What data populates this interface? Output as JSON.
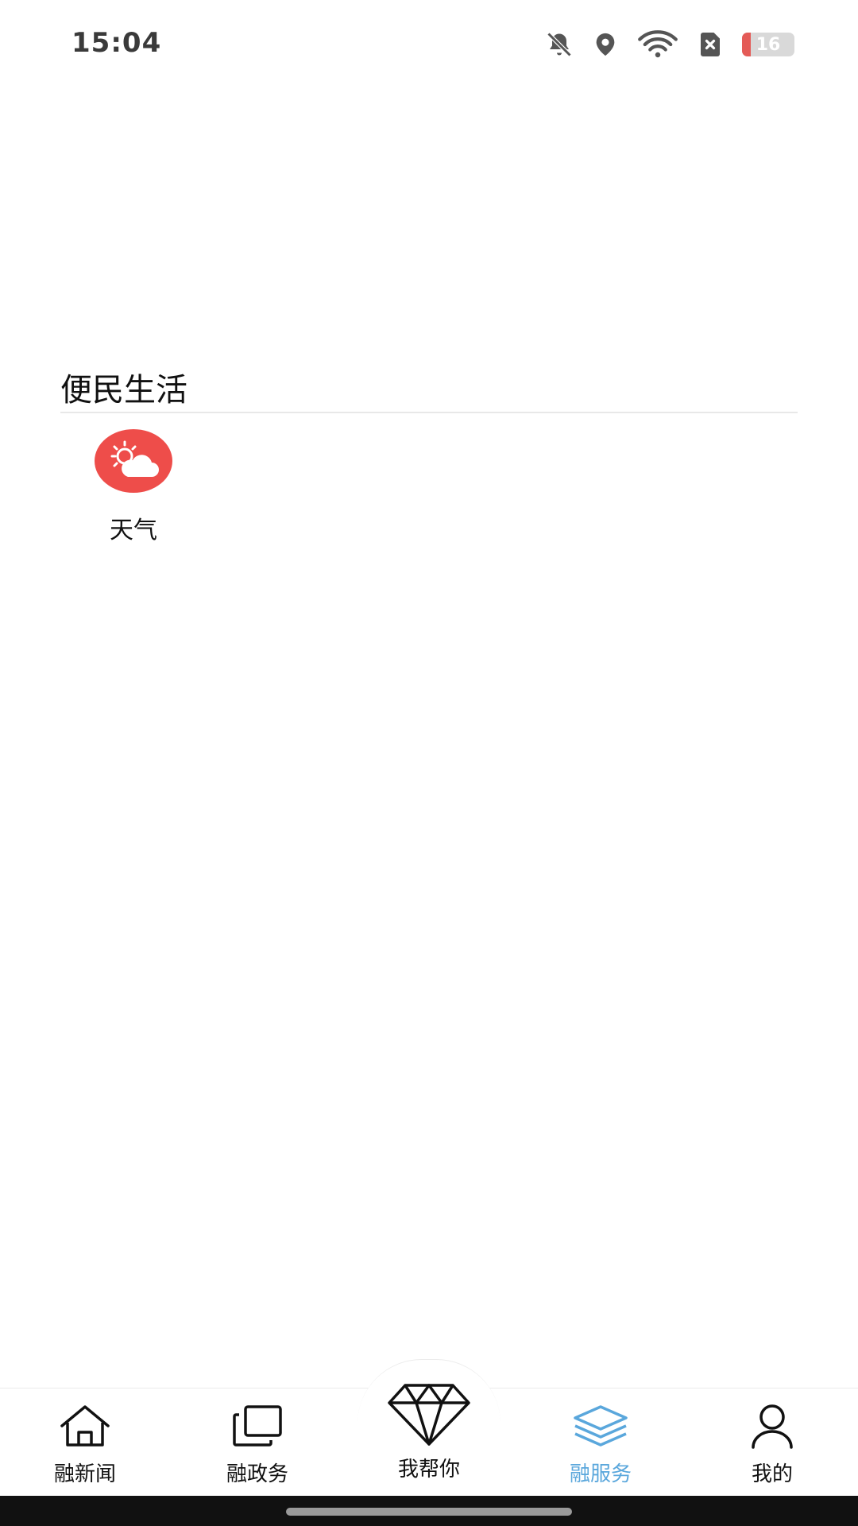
{
  "status_bar": {
    "time": "15:04",
    "battery_level": "16",
    "icons": [
      "bell-muted-icon",
      "location-icon",
      "wifi-icon",
      "sim-error-icon",
      "battery-icon"
    ]
  },
  "section": {
    "title": "便民生活",
    "items": [
      {
        "label": "天气",
        "icon": "weather-icon",
        "icon_color": "#ee4d4a"
      }
    ]
  },
  "bottom_nav": {
    "items": [
      {
        "label": "融新闻",
        "icon": "home-icon"
      },
      {
        "label": "融政务",
        "icon": "stack-icon"
      },
      {
        "label": "我帮你",
        "icon": "diamond-icon"
      },
      {
        "label": "融服务",
        "icon": "layers-icon",
        "active": true
      },
      {
        "label": "我的",
        "icon": "user-icon"
      }
    ],
    "active_color": "#5aa7dc"
  }
}
